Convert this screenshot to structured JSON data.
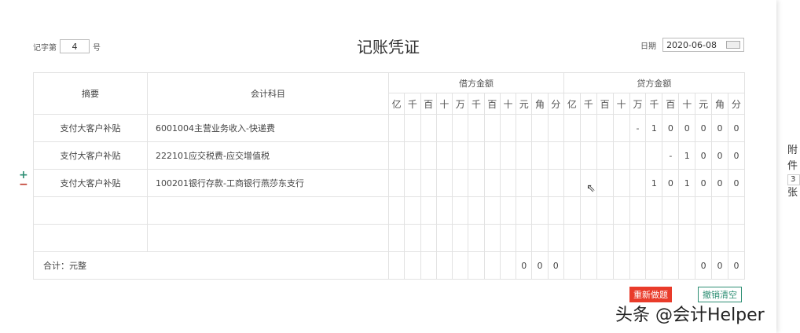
{
  "header": {
    "voucher_prefix": "记字第",
    "voucher_no": "4",
    "voucher_suffix": "号",
    "title": "记账凭证",
    "date_label": "日期",
    "date": "2020-06-08"
  },
  "table": {
    "col_summary": "摘要",
    "col_account": "会计科目",
    "debit_label": "借方金额",
    "credit_label": "贷方金额",
    "digits": [
      "亿",
      "千",
      "百",
      "十",
      "万",
      "千",
      "百",
      "十",
      "元",
      "角",
      "分"
    ],
    "rows": [
      {
        "summary": "支付大客户补贴",
        "account": "6001004主营业务收入-快递费",
        "debit": [
          "",
          "",
          "",
          "",
          "",
          "",
          "",
          "",
          "",
          "",
          ""
        ],
        "credit": [
          "",
          "",
          "",
          "",
          "-",
          "1",
          "0",
          "0",
          "0",
          "0",
          "0"
        ]
      },
      {
        "summary": "支付大客户补贴",
        "account": "222101应交税费-应交增值税",
        "debit": [
          "",
          "",
          "",
          "",
          "",
          "",
          "",
          "",
          "",
          "",
          ""
        ],
        "credit": [
          "",
          "",
          "",
          "",
          "",
          "",
          "-",
          "1",
          "0",
          "0",
          "0"
        ]
      },
      {
        "summary": "支付大客户补贴",
        "account": "100201银行存款-工商银行燕莎东支行",
        "debit": [
          "",
          "",
          "",
          "",
          "",
          "",
          "",
          "",
          "",
          "",
          ""
        ],
        "credit": [
          "",
          "",
          "",
          "",
          "",
          "1",
          "0",
          "1",
          "0",
          "0",
          "0"
        ]
      },
      {
        "summary": "",
        "account": "",
        "debit": [
          "",
          "",
          "",
          "",
          "",
          "",
          "",
          "",
          "",
          "",
          ""
        ],
        "credit": [
          "",
          "",
          "",
          "",
          "",
          "",
          "",
          "",
          "",
          "",
          ""
        ]
      },
      {
        "summary": "",
        "account": "",
        "debit": [
          "",
          "",
          "",
          "",
          "",
          "",
          "",
          "",
          "",
          "",
          ""
        ],
        "credit": [
          "",
          "",
          "",
          "",
          "",
          "",
          "",
          "",
          "",
          "",
          ""
        ]
      }
    ],
    "total_label": "合计：元整",
    "total_debit": [
      "",
      "",
      "",
      "",
      "",
      "",
      "",
      "",
      "0",
      "0",
      "0"
    ],
    "total_credit": [
      "",
      "",
      "",
      "",
      "",
      "",
      "",
      "",
      "0",
      "0",
      "0"
    ]
  },
  "row_controls": {
    "add": "+",
    "remove": "−",
    "add_color": "#2e8f74",
    "remove_color": "#c0392b"
  },
  "buttons": {
    "redo": "重新做题",
    "undo": "撤销清空"
  },
  "attachment": {
    "label1": "附",
    "label2": "件",
    "count": "3",
    "unit": "张"
  },
  "watermark": "头条 @会计Helper",
  "colors": {
    "redo_bg": "#e93b2a",
    "undo_border": "#2e8f74"
  }
}
